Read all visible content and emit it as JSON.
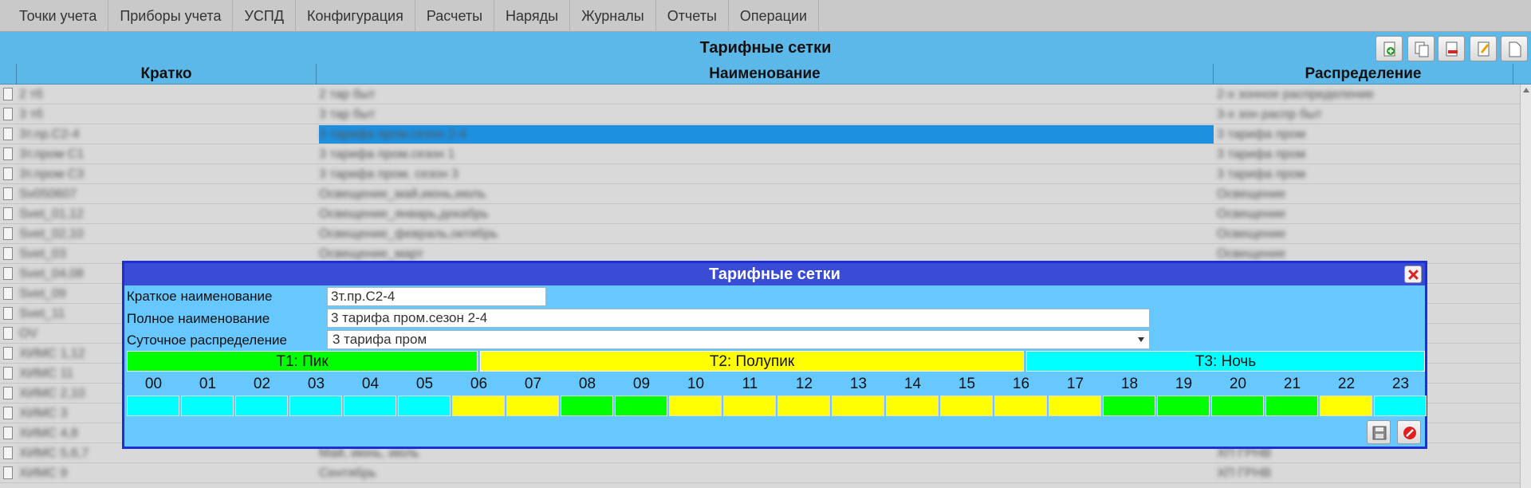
{
  "menu": [
    "Точки учета",
    "Приборы учета",
    "УСПД",
    "Конфигурация",
    "Расчеты",
    "Наряды",
    "Журналы",
    "Отчеты",
    "Операции"
  ],
  "page_title": "Тарифные сетки",
  "toolbar_icons": [
    "add-icon",
    "copy-icon",
    "delete-icon",
    "edit-icon",
    "document-icon"
  ],
  "table": {
    "columns": [
      "Кратко",
      "Наименование",
      "Распределение"
    ],
    "rows": [
      [
        "2 тб",
        "2 тар быт",
        "2-х зонное распределение"
      ],
      [
        "3 тб",
        "3 тар быт",
        "3-х зон распр быт"
      ],
      [
        "3т.пр.С2-4",
        "3 тарифа пром.сезон 2-4",
        "3 тарифа пром"
      ],
      [
        "3т.пром С1",
        "3 тарифа пром.сезон 1",
        "3 тарифа пром"
      ],
      [
        "3т.пром С3",
        "3 тарифа пром. сезон 3",
        "3 тарифа пром"
      ],
      [
        "Sv050607",
        "Освещение_май,июнь,июль",
        "Освещение"
      ],
      [
        "Svet_01,12",
        "Освещение_январь,декабрь",
        "Освещение"
      ],
      [
        "Svet_02,10",
        "Освещение_февраль,октябрь",
        "Освещение"
      ],
      [
        "Svet_03",
        "Освещение_март",
        "Освещение"
      ],
      [
        "Svet_04,08",
        "",
        ""
      ],
      [
        "Svet_09",
        "",
        ""
      ],
      [
        "Svet_11",
        "",
        ""
      ],
      [
        "OV",
        "",
        ""
      ],
      [
        "ХИМС 1,12",
        "",
        ""
      ],
      [
        "ХИМС 11",
        "",
        ""
      ],
      [
        "ХИМС 2,10",
        "",
        ""
      ],
      [
        "ХИМС 3",
        "",
        ""
      ],
      [
        "ХИМС 4,8",
        "",
        ""
      ],
      [
        "ХИМС 5,6,7",
        "Май, июнь, июль",
        "ХП ГРНВ"
      ],
      [
        "ХИМС 9",
        "Сентябрь",
        "ХП ГРНВ"
      ]
    ],
    "selected_row": 2
  },
  "dialog": {
    "title": "Тарифные сетки",
    "short_name_label": "Краткое наименование",
    "short_name_value": "3т.пр.С2-4",
    "full_name_label": "Полное наименование",
    "full_name_value": "3 тарифа пром.сезон 2-4",
    "daily_label": "Суточное распределение",
    "daily_value": "3 тарифа пром",
    "zones": [
      {
        "label": "T1: Пик",
        "color": "#00ff00"
      },
      {
        "label": "T2: Полупик",
        "color": "#ffff00"
      },
      {
        "label": "T3: Ночь",
        "color": "#00ffff"
      }
    ],
    "hours": [
      "00",
      "01",
      "02",
      "03",
      "04",
      "05",
      "06",
      "07",
      "08",
      "09",
      "10",
      "11",
      "12",
      "13",
      "14",
      "15",
      "16",
      "17",
      "18",
      "19",
      "20",
      "21",
      "22",
      "23"
    ],
    "hour_zones": [
      3,
      3,
      3,
      3,
      3,
      3,
      2,
      2,
      1,
      1,
      2,
      2,
      2,
      2,
      2,
      2,
      2,
      2,
      1,
      1,
      1,
      1,
      2,
      3
    ]
  }
}
